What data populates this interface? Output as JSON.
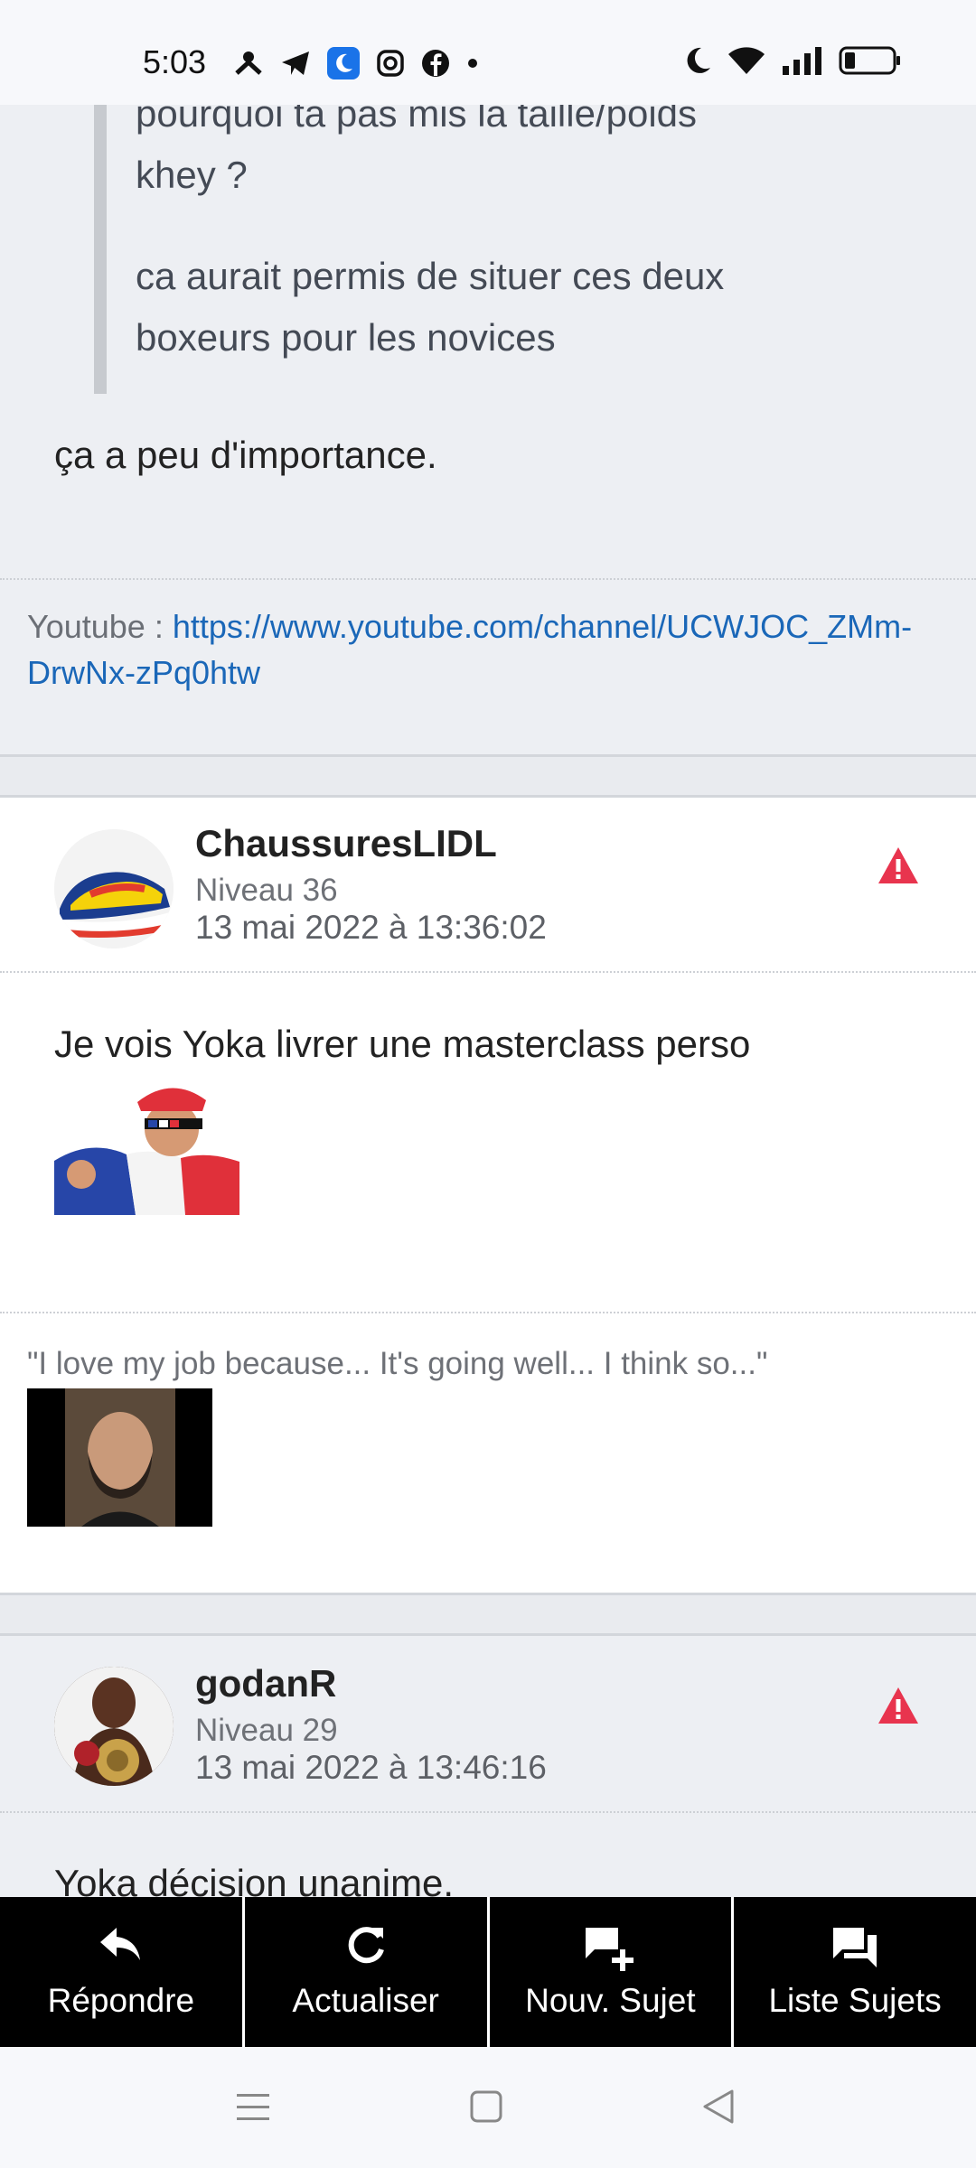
{
  "status": {
    "time": "5:03"
  },
  "prev_post": {
    "quote_lines": [
      "pourquoi ta pas mis la taille/poids",
      "khey ?",
      "ca aurait permis de situer ces deux",
      "boxeurs pour les novices"
    ],
    "body": "ça a peu d'importance.",
    "signature_prefix": "Youtube : ",
    "signature_link": "https://www.youtube.com/channel/UCWJOC_ZMm-DrwNx-zPq0htw"
  },
  "post1": {
    "pseudo": "ChaussuresLIDL",
    "niveau": "Niveau 36",
    "date": "13 mai 2022 à 13:36:02",
    "message": "Je vois Yoka livrer une masterclass perso",
    "signature": "\"I love my job because... It's going well... I think so...\""
  },
  "post2": {
    "pseudo": "godanR",
    "niveau": "Niveau 29",
    "date": "13 mai 2022 à 13:46:16",
    "message": "Yoka décision unanime."
  },
  "actions": [
    {
      "label": "Répondre",
      "icon": "reply-icon"
    },
    {
      "label": "Actualiser",
      "icon": "refresh-icon"
    },
    {
      "label": "Nouv. Sujet",
      "icon": "new-topic-icon"
    },
    {
      "label": "Liste Sujets",
      "icon": "topic-list-icon"
    }
  ],
  "colors": {
    "link": "#1a67b8",
    "alert": "#e8344e",
    "action_bar": "#000000"
  }
}
